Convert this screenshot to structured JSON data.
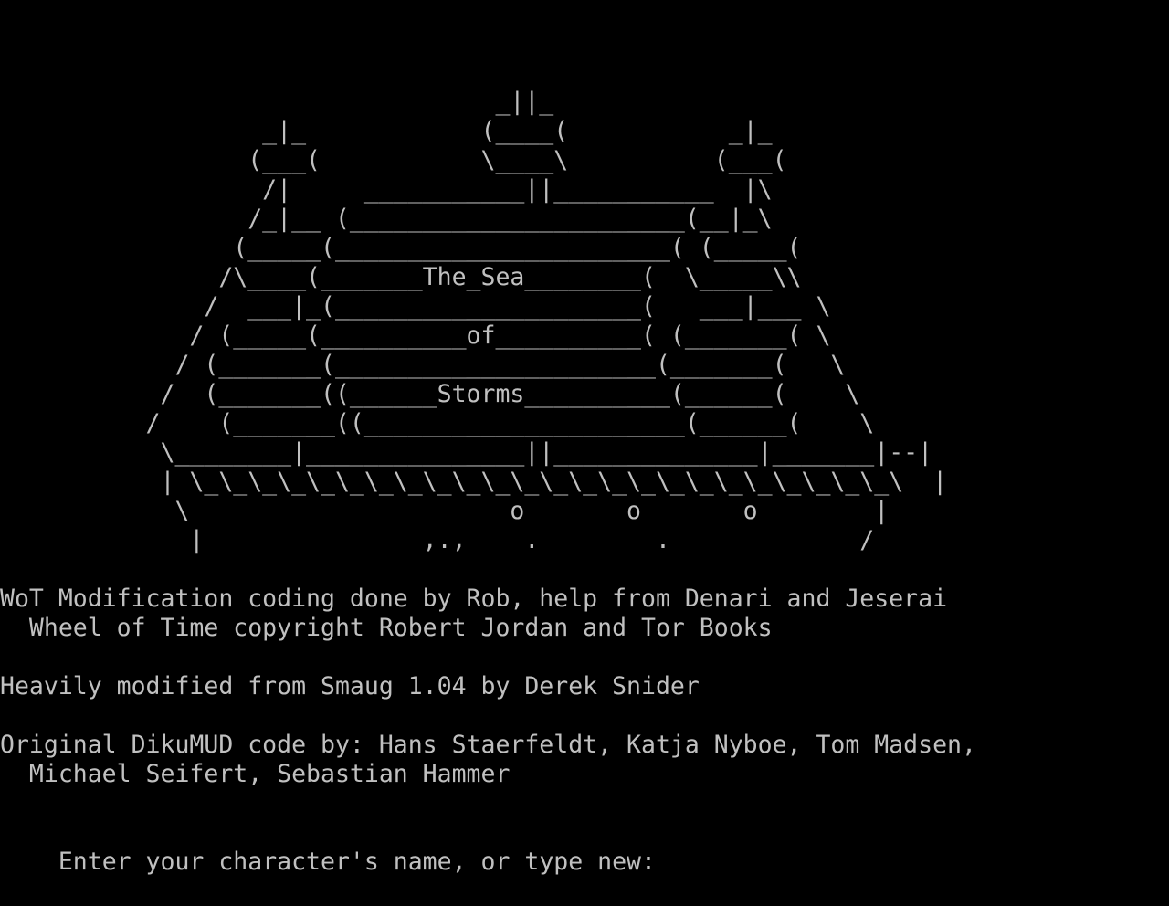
{
  "terminal": {
    "bg_color": "#000000",
    "fg_color": "#c0c0c0",
    "art": [
      "                                  _||_",
      "                  _|_            (____(           _|_",
      "                 (___(           \\____\\          (___(",
      "                  /|     ___________||___________  |\\",
      "                 /_|__ (_______________________(__|_\\",
      "                (_____(_______________________( (_____(",
      "               /\\____(_______The_Sea________(  \\_____\\\\",
      "              /  ___|_(_____________________(   ___|___ \\",
      "             / (_____(__________of__________( (_______( \\",
      "            / (_______(______________________(_______(   \\",
      "           /  (_______((______Storms__________(______(    \\",
      "          /    (_______((______________________(______(    \\",
      "           \\________|_______________||______________|_______|--|",
      "           | \\_\\_\\_\\_\\_\\_\\_\\_\\_\\_\\_\\_\\_\\_\\_\\_\\_\\_\\_\\_\\_\\_\\_\\_\\  |",
      "            \\                      o       o       o        |",
      "             |               ,.,    .        .             /"
    ],
    "credits": [
      "WoT Modification coding done by Rob, help from Denari and Jeserai",
      "  Wheel of Time copyright Robert Jordan and Tor Books",
      "",
      "Heavily modified from Smaug 1.04 by Derek Snider",
      "",
      "Original DikuMUD code by: Hans Staerfeldt, Katja Nyboe, Tom Madsen,",
      "  Michael Seifert, Sebastian Hammer",
      ""
    ],
    "prompt": "Enter your character's name, or type new:"
  }
}
